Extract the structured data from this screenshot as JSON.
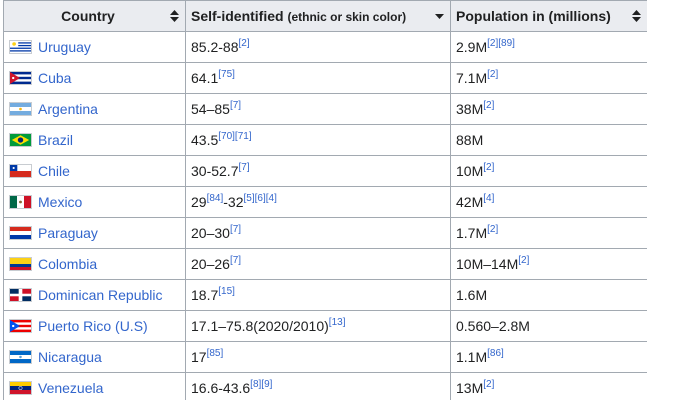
{
  "headers": {
    "country": "Country",
    "self_identified": "Self-identified",
    "self_identified_note": "(ethnic or skin color)",
    "population": "Population in (millions)"
  },
  "rows": [
    {
      "country": "Uruguay",
      "flag": "uruguay-flag-icon",
      "pct": [
        {
          "t": "85.2-88"
        },
        {
          "s": "[2]"
        }
      ],
      "pop": [
        {
          "t": "2.9M"
        },
        {
          "s": "[2][89]"
        }
      ]
    },
    {
      "country": "Cuba",
      "flag": "cuba-flag-icon",
      "pct": [
        {
          "t": "64.1"
        },
        {
          "s": "[75]"
        }
      ],
      "pop": [
        {
          "t": "7.1M"
        },
        {
          "s": "[2]"
        }
      ]
    },
    {
      "country": "Argentina",
      "flag": "argentina-flag-icon",
      "pct": [
        {
          "t": "54–85"
        },
        {
          "s": "[7]"
        }
      ],
      "pop": [
        {
          "t": "38M"
        },
        {
          "s": "[2]"
        }
      ]
    },
    {
      "country": "Brazil",
      "flag": "brazil-flag-icon",
      "pct": [
        {
          "t": "43.5"
        },
        {
          "s": "[70][71]"
        }
      ],
      "pop": [
        {
          "t": "88M"
        }
      ]
    },
    {
      "country": "Chile",
      "flag": "chile-flag-icon",
      "pct": [
        {
          "t": "30-52.7"
        },
        {
          "s": "[7]"
        }
      ],
      "pop": [
        {
          "t": "10M"
        },
        {
          "s": "[2]"
        }
      ]
    },
    {
      "country": "Mexico",
      "flag": "mexico-flag-icon",
      "pct": [
        {
          "t": "29"
        },
        {
          "s": "[84]"
        },
        {
          "t": "-32"
        },
        {
          "s": "[5][6][4]"
        }
      ],
      "pop": [
        {
          "t": "42M"
        },
        {
          "s": "[4]"
        }
      ]
    },
    {
      "country": "Paraguay",
      "flag": "paraguay-flag-icon",
      "pct": [
        {
          "t": "20–30"
        },
        {
          "s": "[7]"
        }
      ],
      "pop": [
        {
          "t": "1.7M"
        },
        {
          "s": "[2]"
        }
      ]
    },
    {
      "country": "Colombia",
      "flag": "colombia-flag-icon",
      "pct": [
        {
          "t": "20–26"
        },
        {
          "s": "[7]"
        }
      ],
      "pop": [
        {
          "t": "10M–14M"
        },
        {
          "s": "[2]"
        }
      ]
    },
    {
      "country": "Dominican Republic",
      "flag": "dominican-republic-flag-icon",
      "pct": [
        {
          "t": "18.7"
        },
        {
          "s": "[15]"
        }
      ],
      "pop": [
        {
          "t": "1.6M"
        }
      ]
    },
    {
      "country": "Puerto Rico (U.S)",
      "flag": "puerto-rico-flag-icon",
      "pct": [
        {
          "t": "17.1–75.8(2020/2010)"
        },
        {
          "s": "[13]"
        }
      ],
      "pop": [
        {
          "t": "0.560–2.8M"
        }
      ]
    },
    {
      "country": "Nicaragua",
      "flag": "nicaragua-flag-icon",
      "pct": [
        {
          "t": "17"
        },
        {
          "s": "[85]"
        }
      ],
      "pop": [
        {
          "t": "1.1M"
        },
        {
          "s": "[86]"
        }
      ]
    },
    {
      "country": "Venezuela",
      "flag": "venezuela-flag-icon",
      "pct": [
        {
          "t": "16.6-43.6"
        },
        {
          "s": "[8][9]"
        }
      ],
      "pop": [
        {
          "t": "13M"
        },
        {
          "s": "[2]"
        }
      ]
    }
  ],
  "colors": {
    "header_bg": "#eaecf0",
    "border": "#a2a9b1",
    "link": "#3366cc",
    "text": "#202122"
  }
}
